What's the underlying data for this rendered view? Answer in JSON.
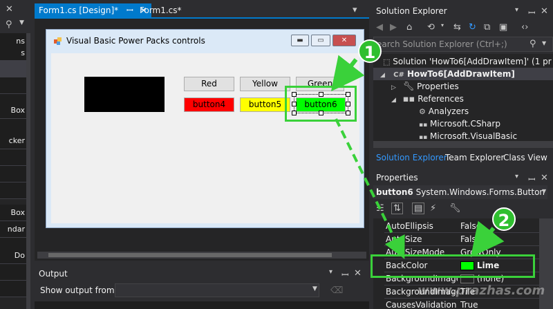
{
  "toolbox": {
    "items": [
      "ns",
      "s",
      "",
      "",
      "",
      "",
      "Box",
      "",
      "cker",
      "",
      "",
      "",
      "Box",
      "ndar",
      "",
      "Do",
      "",
      ""
    ]
  },
  "tabs": [
    {
      "label": "Form1.cs [Design]*",
      "pin": "↕",
      "close": "✕"
    },
    {
      "label": "Form1.cs*",
      "close": "✕"
    }
  ],
  "form": {
    "title": "Visual Basic Power Packs controls",
    "buttons": [
      {
        "label": "Red"
      },
      {
        "label": "Yellow"
      },
      {
        "label": "Green"
      },
      {
        "label": "button4",
        "color": "#ff0000"
      },
      {
        "label": "button5",
        "color": "#ffff00"
      },
      {
        "label": "button6",
        "color": "#00ff00"
      }
    ]
  },
  "annotations": {
    "one": "1",
    "two": "2"
  },
  "output": {
    "title": "Output",
    "show_from_label": "Show output from:"
  },
  "solution_explorer": {
    "title": "Solution Explorer",
    "search_placeholder": "earch Solution Explorer (Ctrl+;)",
    "tree": [
      {
        "label": "Solution 'HowTo6[AddDrawItem]' (1 pr"
      },
      {
        "label": "HowTo6[AddDrawItem]"
      },
      {
        "label": "Properties"
      },
      {
        "label": "References"
      },
      {
        "label": "Analyzers"
      },
      {
        "label": "Microsoft.CSharp"
      },
      {
        "label": "Microsoft.VisualBasic"
      }
    ],
    "tabs": [
      "Solution Explorer",
      "Team Explorer",
      "Class View"
    ]
  },
  "properties": {
    "title": "Properties",
    "object_name": "button6",
    "object_type": "System.Windows.Forms.Button",
    "rows": [
      {
        "name": "AutoEllipsis",
        "value": "False"
      },
      {
        "name": "AutoSize",
        "value": "False"
      },
      {
        "name": "AutoSizeMode",
        "value": "GrowOnly"
      },
      {
        "name": "BackColor",
        "value": "Lime"
      },
      {
        "name": "BackgroundImage",
        "value": "(none)"
      },
      {
        "name": "BackgroundImageLayout",
        "value": "Tile"
      },
      {
        "name": "CausesValidation",
        "value": "True"
      }
    ],
    "backcolor_swatch": "#00ff00"
  },
  "watermark": "www.prazhas.com",
  "colors": {
    "accent": "#007acc",
    "annotation": "#3ad13a"
  }
}
